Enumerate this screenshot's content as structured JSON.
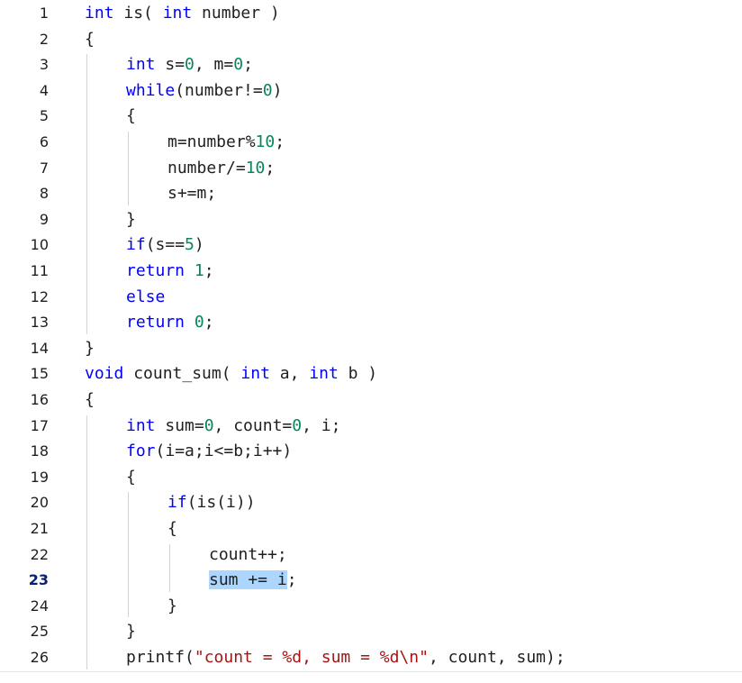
{
  "editor": {
    "language": "c",
    "selected_text": "sum += i",
    "lines": [
      {
        "n": "1",
        "indent": 0,
        "tokens": [
          {
            "t": "int",
            "c": "kw"
          },
          {
            "t": " is( ",
            "c": "plain"
          },
          {
            "t": "int",
            "c": "kw"
          },
          {
            "t": " number )",
            "c": "plain"
          }
        ]
      },
      {
        "n": "2",
        "indent": 0,
        "tokens": [
          {
            "t": "{",
            "c": "plain"
          }
        ]
      },
      {
        "n": "3",
        "indent": 1,
        "tokens": [
          {
            "t": "int",
            "c": "kw"
          },
          {
            "t": " s=",
            "c": "plain"
          },
          {
            "t": "0",
            "c": "num"
          },
          {
            "t": ", m=",
            "c": "plain"
          },
          {
            "t": "0",
            "c": "num"
          },
          {
            "t": ";",
            "c": "plain"
          }
        ]
      },
      {
        "n": "4",
        "indent": 1,
        "tokens": [
          {
            "t": "while",
            "c": "kw"
          },
          {
            "t": "(number!=",
            "c": "plain"
          },
          {
            "t": "0",
            "c": "num"
          },
          {
            "t": ")",
            "c": "plain"
          }
        ]
      },
      {
        "n": "5",
        "indent": 1,
        "tokens": [
          {
            "t": "{",
            "c": "plain"
          }
        ]
      },
      {
        "n": "6",
        "indent": 2,
        "tokens": [
          {
            "t": "m=number%",
            "c": "plain"
          },
          {
            "t": "10",
            "c": "num"
          },
          {
            "t": ";",
            "c": "plain"
          }
        ]
      },
      {
        "n": "7",
        "indent": 2,
        "tokens": [
          {
            "t": "number/=",
            "c": "plain"
          },
          {
            "t": "10",
            "c": "num"
          },
          {
            "t": ";",
            "c": "plain"
          }
        ]
      },
      {
        "n": "8",
        "indent": 2,
        "tokens": [
          {
            "t": "s+=m;",
            "c": "plain"
          }
        ]
      },
      {
        "n": "9",
        "indent": 1,
        "tokens": [
          {
            "t": "}",
            "c": "plain"
          }
        ]
      },
      {
        "n": "10",
        "indent": 1,
        "tokens": [
          {
            "t": "if",
            "c": "kw"
          },
          {
            "t": "(s==",
            "c": "plain"
          },
          {
            "t": "5",
            "c": "num"
          },
          {
            "t": ")",
            "c": "plain"
          }
        ]
      },
      {
        "n": "11",
        "indent": 1,
        "tokens": [
          {
            "t": "return",
            "c": "kw"
          },
          {
            "t": " ",
            "c": "plain"
          },
          {
            "t": "1",
            "c": "num"
          },
          {
            "t": ";",
            "c": "plain"
          }
        ]
      },
      {
        "n": "12",
        "indent": 1,
        "tokens": [
          {
            "t": "else",
            "c": "kw"
          }
        ]
      },
      {
        "n": "13",
        "indent": 1,
        "tokens": [
          {
            "t": "return",
            "c": "kw"
          },
          {
            "t": " ",
            "c": "plain"
          },
          {
            "t": "0",
            "c": "num"
          },
          {
            "t": ";",
            "c": "plain"
          }
        ]
      },
      {
        "n": "14",
        "indent": 0,
        "tokens": [
          {
            "t": "}",
            "c": "plain"
          }
        ]
      },
      {
        "n": "15",
        "indent": 0,
        "tokens": [
          {
            "t": "void",
            "c": "kw"
          },
          {
            "t": " count_sum( ",
            "c": "plain"
          },
          {
            "t": "int",
            "c": "kw"
          },
          {
            "t": " a, ",
            "c": "plain"
          },
          {
            "t": "int",
            "c": "kw"
          },
          {
            "t": " b )",
            "c": "plain"
          }
        ]
      },
      {
        "n": "16",
        "indent": 0,
        "tokens": [
          {
            "t": "{",
            "c": "plain"
          }
        ]
      },
      {
        "n": "17",
        "indent": 1,
        "tokens": [
          {
            "t": "int",
            "c": "kw"
          },
          {
            "t": " sum=",
            "c": "plain"
          },
          {
            "t": "0",
            "c": "num"
          },
          {
            "t": ", count=",
            "c": "plain"
          },
          {
            "t": "0",
            "c": "num"
          },
          {
            "t": ", i;",
            "c": "plain"
          }
        ]
      },
      {
        "n": "18",
        "indent": 1,
        "tokens": [
          {
            "t": "for",
            "c": "kw"
          },
          {
            "t": "(i=a;i<=b;i++)",
            "c": "plain"
          }
        ]
      },
      {
        "n": "19",
        "indent": 1,
        "tokens": [
          {
            "t": "{",
            "c": "plain"
          }
        ]
      },
      {
        "n": "20",
        "indent": 2,
        "tokens": [
          {
            "t": "if",
            "c": "kw"
          },
          {
            "t": "(is(i))",
            "c": "plain"
          }
        ]
      },
      {
        "n": "21",
        "indent": 2,
        "tokens": [
          {
            "t": "{",
            "c": "plain"
          }
        ]
      },
      {
        "n": "22",
        "indent": 3,
        "tokens": [
          {
            "t": "count++;",
            "c": "plain"
          }
        ]
      },
      {
        "n": "23",
        "indent": 3,
        "tokens": [
          {
            "t": "sum += i",
            "c": "sel"
          },
          {
            "t": ";",
            "c": "plain"
          }
        ],
        "current": true
      },
      {
        "n": "24",
        "indent": 2,
        "tokens": [
          {
            "t": "}",
            "c": "plain"
          }
        ]
      },
      {
        "n": "25",
        "indent": 1,
        "tokens": [
          {
            "t": "}",
            "c": "plain"
          }
        ]
      },
      {
        "n": "26",
        "indent": 1,
        "tokens": [
          {
            "t": "printf(",
            "c": "plain"
          },
          {
            "t": "\"count = %d, sum = %d\\n\"",
            "c": "str"
          },
          {
            "t": ", count, sum);",
            "c": "plain"
          }
        ]
      }
    ]
  },
  "colors": {
    "keyword": "#0000ff",
    "number": "#098658",
    "string": "#a31515",
    "text": "#1f1f1f",
    "selection": "#add6ff",
    "indent_guide": "#d3d3d3"
  }
}
